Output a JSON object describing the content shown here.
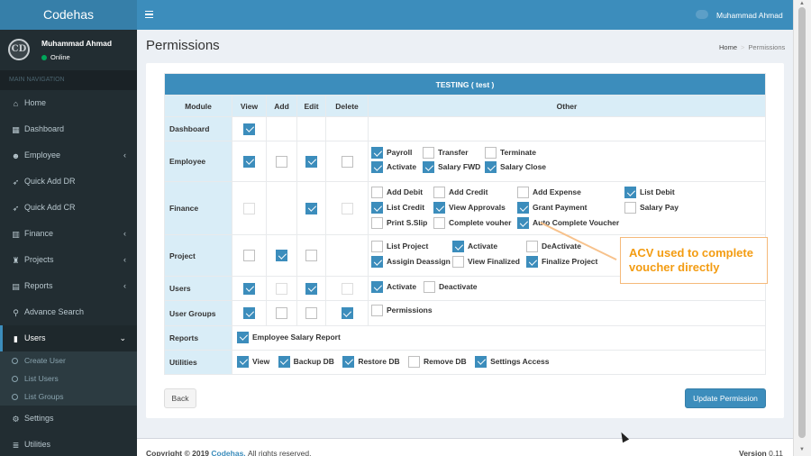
{
  "app": {
    "title": "Codehas"
  },
  "user": {
    "name": "Muhammad Ahmad",
    "status": "Online",
    "avatar_initials": "CD",
    "status_color": "#00a65a"
  },
  "sidebar": {
    "header": "MAIN NAVIGATION",
    "items": [
      {
        "label": "Home",
        "icon": "home-icon",
        "glyph": "⌂"
      },
      {
        "label": "Dashboard",
        "icon": "dashboard-icon",
        "glyph": "▦"
      },
      {
        "label": "Employee",
        "icon": "users-icon",
        "glyph": "☻",
        "chevron": "‹"
      },
      {
        "label": "Quick Add DR",
        "icon": "rocket-icon",
        "glyph": "➶"
      },
      {
        "label": "Quick Add CR",
        "icon": "rocket-icon",
        "glyph": "➶"
      },
      {
        "label": "Finance",
        "icon": "bar-chart-icon",
        "glyph": "▥",
        "chevron": "‹"
      },
      {
        "label": "Projects",
        "icon": "flask-icon",
        "glyph": "♜",
        "chevron": "‹"
      },
      {
        "label": "Reports",
        "icon": "report-icon",
        "glyph": "▤",
        "chevron": "‹"
      },
      {
        "label": "Advance Search",
        "icon": "search-icon",
        "glyph": "⚲"
      },
      {
        "label": "Users",
        "icon": "lock-icon",
        "glyph": "▮",
        "chevron": "⌄"
      },
      {
        "label": "Settings",
        "icon": "cogs-icon",
        "glyph": "⚙"
      },
      {
        "label": "Utilities",
        "icon": "database-icon",
        "glyph": "≣"
      }
    ],
    "users_submenu": [
      "Create User",
      "List Users",
      "List Groups"
    ]
  },
  "page": {
    "title": "Permissions",
    "breadcrumb": {
      "home": "Home",
      "current": "Permissions",
      "sep": ">"
    }
  },
  "table": {
    "title": "TESTING ( test )",
    "columns": [
      "Module",
      "View",
      "Add",
      "Edit",
      "Delete",
      "Other"
    ],
    "rows": {
      "dashboard": {
        "module": "Dashboard"
      },
      "employee": {
        "module": "Employee",
        "other": [
          "Payroll",
          "Transfer",
          "Terminate",
          "Activate",
          "Salary FWD",
          "Salary Close"
        ]
      },
      "finance": {
        "module": "Finance",
        "other": [
          "Add Debit",
          "Add Credit",
          "Add Expense",
          "List Debit",
          "List Credit",
          "View Approvals",
          "Grant Payment",
          "Salary Pay",
          "Print S.Slip",
          "Complete vouher",
          "Auto Complete Voucher"
        ]
      },
      "project": {
        "module": "Project",
        "other": [
          "List Project",
          "Activate",
          "DeActivate",
          "Assigin Deassign",
          "View Finalized",
          "Finalize Project"
        ]
      },
      "users": {
        "module": "Users",
        "other": [
          "Activate",
          "Deactivate"
        ]
      },
      "user_groups": {
        "module": "User Groups",
        "other": [
          "Permissions"
        ]
      },
      "reports": {
        "module": "Reports",
        "other": [
          "Employee Salary Report"
        ]
      },
      "utilities": {
        "module": "Utilities",
        "other": [
          "View",
          "Backup DB",
          "Restore DB",
          "Remove DB",
          "Settings Access"
        ]
      }
    }
  },
  "annotation": {
    "line1": "ACV used to complete",
    "line2": "voucher directly",
    "color": "#f39c12"
  },
  "buttons": {
    "back": "Back",
    "update": "Update Permission"
  },
  "footer": {
    "copyright": "Copyright © 2019",
    "brand": "Codehas.",
    "rights": "All rights reserved.",
    "version_label": "Version",
    "version": "0.11"
  },
  "colors": {
    "primary": "#3c8dbc",
    "sidebar": "#222d32",
    "header_cell": "#d9edf7"
  }
}
